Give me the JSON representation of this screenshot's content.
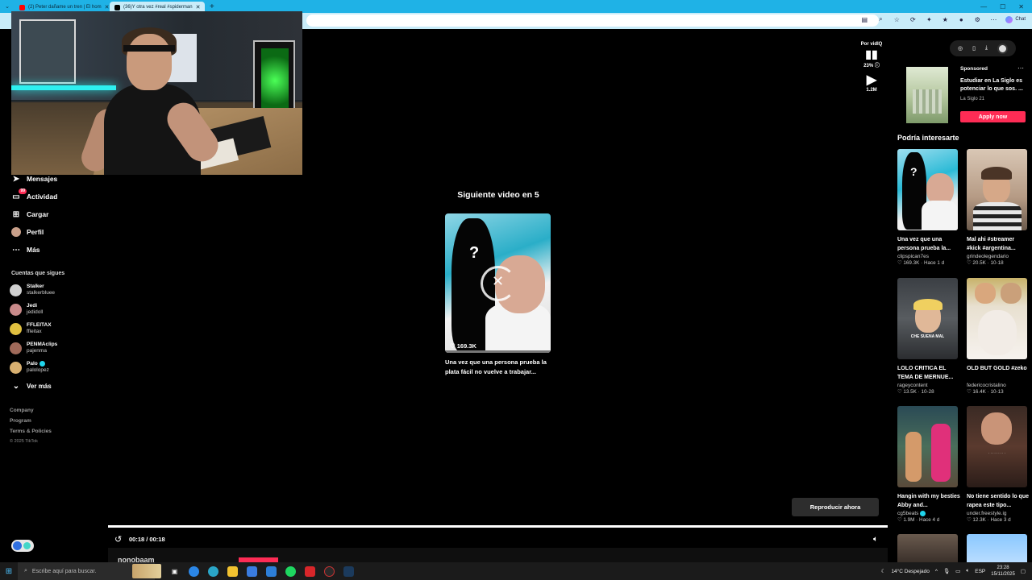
{
  "browser": {
    "tabs": [
      {
        "title": "(2) Peter dañame un tren | El hom",
        "favicon_color": "#ff0000",
        "active": false
      },
      {
        "title": "(36)Y otra vez #real #spiderman",
        "favicon_color": "#000000",
        "active": true
      }
    ],
    "new_tab": "+",
    "chat_label": "Chat"
  },
  "sidebar": {
    "nav": [
      {
        "label": "Mensajes",
        "icon": "send-icon",
        "badge": ""
      },
      {
        "label": "Actividad",
        "icon": "inbox-icon",
        "badge": "99"
      },
      {
        "label": "Cargar",
        "icon": "plus-square-icon",
        "badge": ""
      },
      {
        "label": "Perfil",
        "icon": "profile-avatar-icon",
        "badge": ""
      },
      {
        "label": "Más",
        "icon": "more-dots-icon",
        "badge": ""
      }
    ],
    "following_label": "Cuentas que sigues",
    "following": [
      {
        "name": "Stalker",
        "handle": "stalkerbluee",
        "color": "#d0d0d0",
        "verified": false
      },
      {
        "name": "Jedi",
        "handle": "jedidoll",
        "color": "#c98a8a",
        "verified": false
      },
      {
        "name": "FFLEITAX",
        "handle": "ffleitax",
        "color": "#e0c040",
        "verified": false
      },
      {
        "name": "PENMAclips",
        "handle": "pajenma",
        "color": "#a06a5a",
        "verified": false
      },
      {
        "name": "Palo",
        "handle": "palolopez",
        "color": "#d8b070",
        "verified": true
      }
    ],
    "see_more": "Ver más",
    "footer": [
      "Company",
      "Program",
      "Terms & Policies"
    ],
    "copyright": "© 2025 TikTok"
  },
  "main": {
    "next_heading": "Siguiente video en 5",
    "next_video": {
      "likes": "169.3K",
      "description": "Una vez que una persona prueba la plata fácil no vuelve a trabajar..."
    },
    "actions": {
      "top_label": "Por vidIQ",
      "percent": "23%",
      "views": "1.2M"
    },
    "replay_button": "Reproducir ahora",
    "time": "00:18 / 00:18",
    "author_partial": "nonobaam"
  },
  "right": {
    "ad": {
      "sponsored": "Sponsored",
      "title": "Estudiar en La Siglo es potenciar lo que sos. ...",
      "brand": "La Siglo 21",
      "cta": "Apply now"
    },
    "heading": "Podría interesarte",
    "recs": [
      {
        "title": "Una vez que una persona prueba la...",
        "user": "clipspican7es",
        "likes": "169.3K",
        "age": "Hace 1 d",
        "verified": false
      },
      {
        "title": "Mal ahi #streamer #kick #argentina...",
        "user": "grindeolegendario",
        "likes": "20.5K",
        "age": "10-18",
        "verified": false
      },
      {
        "title": "LOLO CRITICA EL TEMA DE MERNUE...",
        "user": "rageycontent",
        "likes": "13.5K",
        "age": "10-28",
        "verified": false,
        "caption": "CHE SUENA MAL"
      },
      {
        "title": "OLD BUT GOLD #zeko",
        "user": "federicocristalino",
        "likes": "16.4K",
        "age": "10-13",
        "verified": false
      },
      {
        "title": "Hangin with my besties Abby and...",
        "user": "cg5beats",
        "likes": "1.9M",
        "age": "Hace 4 d",
        "verified": true
      },
      {
        "title": "No tiene sentido lo que rapea este tipo...",
        "user": "under.freestyle.ig",
        "likes": "12.3K",
        "age": "Hace 3 d",
        "verified": false
      }
    ]
  },
  "taskbar": {
    "search_placeholder": "Escribe aquí para buscar.",
    "weather": "14°C  Despejado",
    "lang": "ESP",
    "time": "23:28",
    "date": "15/11/2025"
  }
}
